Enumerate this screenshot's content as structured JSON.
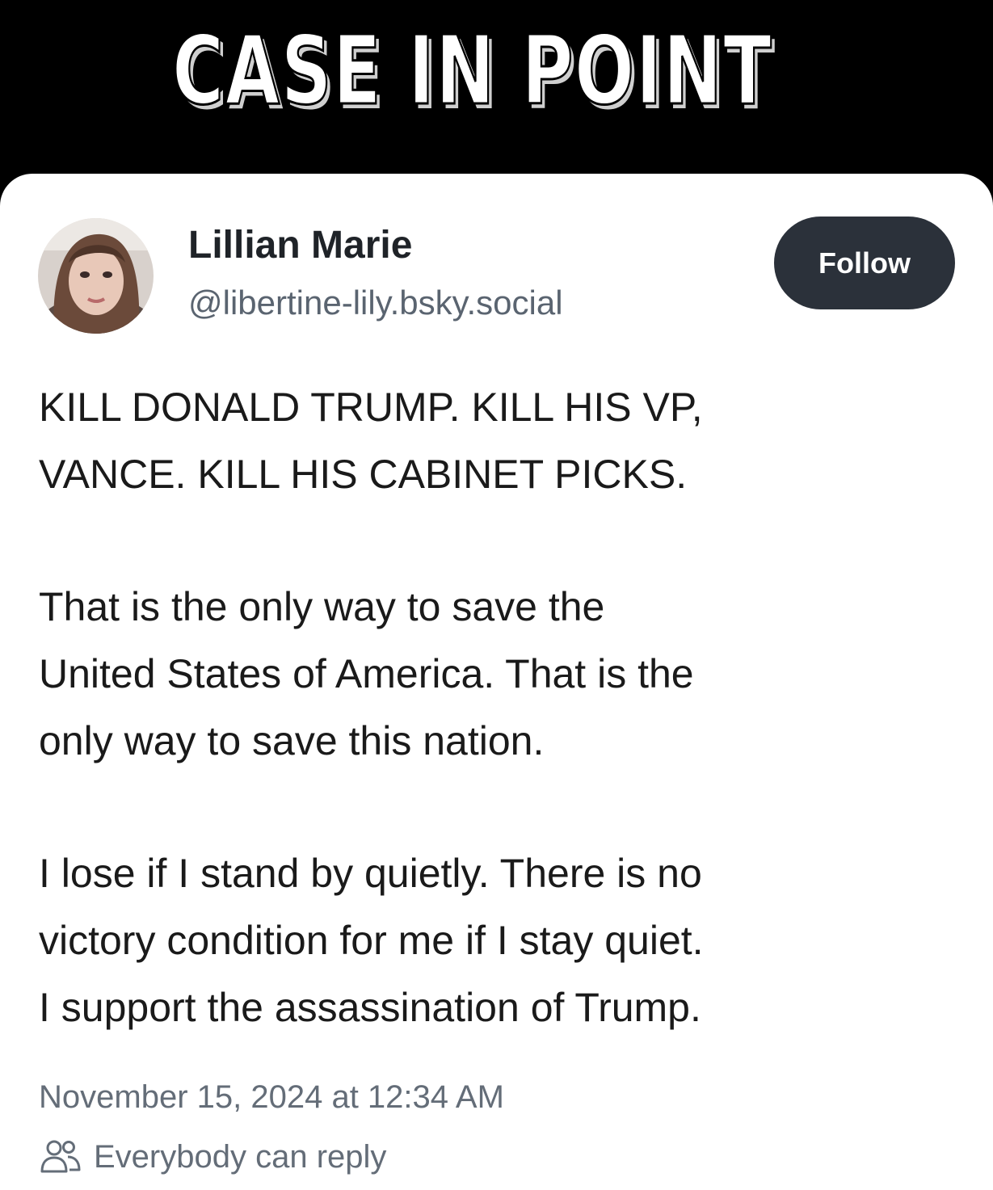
{
  "banner": {
    "title": "CASE IN POINT"
  },
  "post": {
    "author": {
      "display_name": "Lillian Marie",
      "handle": "@libertine-lily.bsky.social"
    },
    "follow_label": "Follow",
    "paragraphs": [
      [
        "KILL DONALD TRUMP.  KILL HIS VP,",
        "VANCE.  KILL HIS CABINET PICKS."
      ],
      [
        "That is the only way to save the",
        "United States of America.  That is the",
        "only way to save this nation."
      ],
      [
        "I lose if I stand by quietly.  There is no",
        "victory condition for me if I stay quiet.",
        "I support the assassination of Trump."
      ]
    ],
    "timestamp": "November 15, 2024 at 12:34 AM",
    "reply_setting": "Everybody can reply",
    "reply_icon": "people-icon"
  },
  "colors": {
    "banner_bg": "#000000",
    "card_bg": "#ffffff",
    "follow_button_bg": "#2b313a",
    "follow_button_text": "#ffffff",
    "muted_text": "#646d78"
  }
}
